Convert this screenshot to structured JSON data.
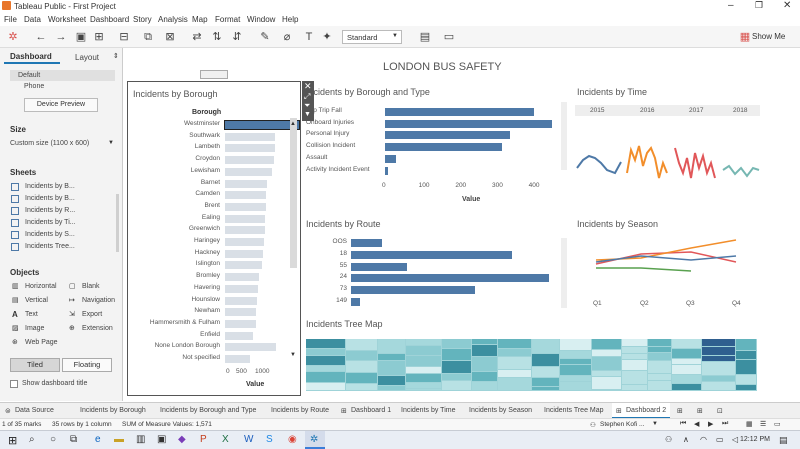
{
  "window": {
    "title": "Tableau Public - First Project"
  },
  "menu": [
    "File",
    "Data",
    "Worksheet",
    "Dashboard",
    "Story",
    "Analysis",
    "Map",
    "Format",
    "Window",
    "Help"
  ],
  "toolbar": {
    "view_select": "Standard",
    "show_me": "Show Me"
  },
  "left": {
    "tab_dashboard": "Dashboard",
    "tab_layout": "Layout",
    "device_default": "Default",
    "device_phone": "Phone",
    "device_preview": "Device Preview",
    "size_label": "Size",
    "size_value": "Custom size (1100 x 600)",
    "sheets_label": "Sheets",
    "sheets": [
      "Incidents by B...",
      "Incidents by B...",
      "Incidents by R...",
      "Incidents by Ti...",
      "Incidents by S...",
      "Incidents Tree..."
    ],
    "objects_label": "Objects",
    "objects": [
      "Horizontal",
      "Blank",
      "Vertical",
      "Navigation",
      "Text",
      "Export",
      "Image",
      "Extension",
      "Web Page"
    ],
    "tiled": "Tiled",
    "floating": "Floating",
    "show_title": "Show dashboard title"
  },
  "dashboard": {
    "title": "LONDON BUS SAFETY"
  },
  "borough_chart": {
    "title": "Incidents by Borough",
    "header": "Borough",
    "axis_label": "Value",
    "ticks": [
      "0",
      "500",
      "1000"
    ],
    "rows": [
      {
        "name": "Westminster",
        "value": 1240
      },
      {
        "name": "Southwark",
        "value": 840
      },
      {
        "name": "Lambeth",
        "value": 830
      },
      {
        "name": "Croydon",
        "value": 810
      },
      {
        "name": "Lewisham",
        "value": 790
      },
      {
        "name": "Barnet",
        "value": 700
      },
      {
        "name": "Camden",
        "value": 690
      },
      {
        "name": "Brent",
        "value": 680
      },
      {
        "name": "Ealing",
        "value": 670
      },
      {
        "name": "Greenwich",
        "value": 660
      },
      {
        "name": "Haringey",
        "value": 650
      },
      {
        "name": "Hackney",
        "value": 640
      },
      {
        "name": "Islington",
        "value": 610
      },
      {
        "name": "Bromley",
        "value": 560
      },
      {
        "name": "Havering",
        "value": 550
      },
      {
        "name": "Hounslow",
        "value": 540
      },
      {
        "name": "Newham",
        "value": 520
      },
      {
        "name": "Hammersmith & Fulham",
        "value": 510
      },
      {
        "name": "Enfield",
        "value": 460
      },
      {
        "name": "None London Borough",
        "value": 850
      },
      {
        "name": "Not specified",
        "value": 420
      }
    ]
  },
  "type_chart": {
    "title": "Incidents by Borough and Type",
    "axis_label": "Value",
    "ticks": [
      "0",
      "100",
      "200",
      "300",
      "400"
    ],
    "rows": [
      {
        "name": "Slip Trip Fall",
        "value": 405
      },
      {
        "name": "Onboard Injuries",
        "value": 455
      },
      {
        "name": "Personal Injury",
        "value": 340
      },
      {
        "name": "Collision Incident",
        "value": 320
      },
      {
        "name": "Assault",
        "value": 30
      },
      {
        "name": "Activity Incident Event",
        "value": 8
      }
    ]
  },
  "route_chart": {
    "title": "Incidents by Route",
    "rows": [
      {
        "name": "OOS",
        "value": 50
      },
      {
        "name": "18",
        "value": 260
      },
      {
        "name": "55",
        "value": 90
      },
      {
        "name": "24",
        "value": 320
      },
      {
        "name": "73",
        "value": 200
      },
      {
        "name": "149",
        "value": 15
      }
    ]
  },
  "time_chart": {
    "title": "Incidents by Time",
    "years": [
      "2015",
      "2016",
      "2017",
      "2018"
    ]
  },
  "season_chart": {
    "title": "Incidents by Season",
    "quarters": [
      "Q1",
      "Q2",
      "Q3",
      "Q4"
    ]
  },
  "tree_chart": {
    "title": "Incidents Tree Map"
  },
  "tabs": [
    "Data Source",
    "Incidents by Borough",
    "Incidents by Borough and Type",
    "Incidents by Route",
    "Dashboard 1",
    "Incidents by Time",
    "Incidents by Season",
    "Incidents Tree Map",
    "Dashboard 2"
  ],
  "status": {
    "marks": "1 of 35 marks",
    "rows": "35 rows by 1 column",
    "sum": "SUM of Measure Values: 1,571",
    "user": "Stephen Kofi ..."
  },
  "taskbar": {
    "time": "12:12 PM"
  }
}
